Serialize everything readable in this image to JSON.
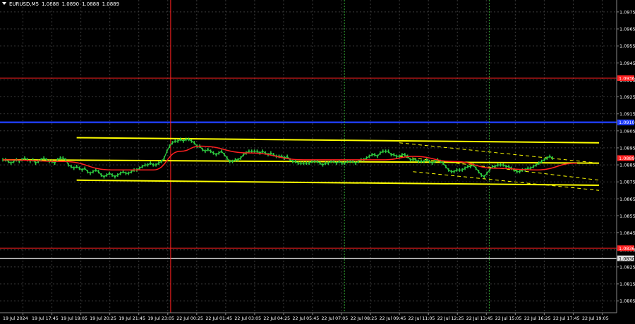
{
  "header": {
    "symbol": "EURUSD,M5",
    "quote": [
      "1.0888",
      "1.0890",
      "1.0888",
      "1.0889"
    ]
  },
  "colors": {
    "background": "#000000",
    "grid": "#3a3a3a",
    "price_line_main": "#2ecc40",
    "channel": "#ffff00",
    "ma": "#ff2020",
    "support_blue": "#1e3cff",
    "red_level": "#ff2020",
    "white_level": "#e0e0e0",
    "vline_red": "#ff2020",
    "vline_green": "#33aa33"
  },
  "price_axis": {
    "ticks": [
      "1.0975",
      "1.0965",
      "1.0955",
      "1.0945",
      "1.0935",
      "1.0925",
      "1.0915",
      "1.0905",
      "1.0895",
      "1.0885",
      "1.0875",
      "1.0865",
      "1.0855",
      "1.0845",
      "1.0835",
      "1.0825",
      "1.0815",
      "1.0805"
    ],
    "level_labels": {
      "red_top": "1.0936",
      "blue": "1.0910",
      "current": "1.0889",
      "red_bottom": "1.0836",
      "white": "1.0830"
    }
  },
  "time_axis": {
    "labels": [
      "19 Jul 2024",
      "19 Jul 17:45",
      "19 Jul 19:05",
      "19 Jul 20:25",
      "19 Jul 21:45",
      "19 Jul 23:05",
      "22 Jul 00:25",
      "22 Jul 01:45",
      "22 Jul 03:05",
      "22 Jul 04:25",
      "22 Jul 05:45",
      "22 Jul 07:05",
      "22 Jul 08:25",
      "22 Jul 09:45",
      "22 Jul 11:05",
      "22 Jul 12:25",
      "22 Jul 13:45",
      "22 Jul 15:05",
      "22 Jul 16:25",
      "22 Jul 17:45",
      "22 Jul 19:05"
    ]
  },
  "chart_data": {
    "type": "line",
    "symbol": "EURUSD,M5",
    "ylim": [
      1.0798,
      1.0982
    ],
    "grid": true,
    "x_index_range": [
      0,
      210
    ],
    "price_series": [
      1.0888,
      1.0888,
      1.0887,
      1.0886,
      1.0887,
      1.0888,
      1.0887,
      1.0888,
      1.0889,
      1.0888,
      1.0887,
      1.0888,
      1.0886,
      1.0887,
      1.0888,
      1.0889,
      1.0888,
      1.0887,
      1.0887,
      1.0886,
      1.0888,
      1.0889,
      1.0889,
      1.0888,
      1.0885,
      1.0884,
      1.0883,
      1.0884,
      1.0883,
      1.0882,
      1.0883,
      1.0881,
      1.088,
      1.0881,
      1.0882,
      1.0881,
      1.0879,
      1.0878,
      1.0879,
      1.088,
      1.0879,
      1.0878,
      1.0879,
      1.088,
      1.0881,
      1.088,
      1.088,
      1.0881,
      1.0882,
      1.0882,
      1.0883,
      1.0884,
      1.0885,
      1.0885,
      1.0886,
      1.0885,
      1.0885,
      1.0886,
      1.0887,
      1.0889,
      1.0893,
      1.0896,
      1.0898,
      1.0899,
      1.0899,
      1.09,
      1.0899,
      1.09,
      1.09,
      1.0899,
      1.0898,
      1.0896,
      1.0896,
      1.0894,
      1.0893,
      1.0894,
      1.0893,
      1.0892,
      1.0891,
      1.0892,
      1.0893,
      1.0891,
      1.0889,
      1.0887,
      1.0887,
      1.0888,
      1.0888,
      1.0889,
      1.0891,
      1.0892,
      1.0893,
      1.0893,
      1.0893,
      1.0893,
      1.0892,
      1.0893,
      1.0892,
      1.0891,
      1.0892,
      1.0891,
      1.089,
      1.089,
      1.089,
      1.0889,
      1.089,
      1.0888,
      1.0887,
      1.0887,
      1.0886,
      1.0886,
      1.0886,
      1.0886,
      1.0886,
      1.0887,
      1.0887,
      1.0887,
      1.0886,
      1.0885,
      1.0886,
      1.0886,
      1.0887,
      1.0887,
      1.0886,
      1.0887,
      1.0886,
      1.0886,
      1.0887,
      1.0887,
      1.0887,
      1.0886,
      1.0887,
      1.0888,
      1.0888,
      1.0889,
      1.089,
      1.0891,
      1.0891,
      1.089,
      1.0892,
      1.0893,
      1.0893,
      1.0893,
      1.0891,
      1.0891,
      1.089,
      1.089,
      1.0891,
      1.0891,
      1.089,
      1.0888,
      1.0888,
      1.0888,
      1.0887,
      1.0887,
      1.0887,
      1.0888,
      1.0887,
      1.0886,
      1.0887,
      1.0888,
      1.0887,
      1.0886,
      1.0884,
      1.0882,
      1.0881,
      1.0881,
      1.0882,
      1.0882,
      1.0882,
      1.0883,
      1.0884,
      1.0884,
      1.0885,
      1.0883,
      1.0881,
      1.0879,
      1.0878,
      1.088,
      1.0882,
      1.0884,
      1.0884,
      1.0885,
      1.0885,
      1.0885,
      1.0884,
      1.0884,
      1.0883,
      1.0882,
      1.0881,
      1.0881,
      1.0882,
      1.0882,
      1.0883,
      1.0883,
      1.0884,
      1.0885,
      1.0886,
      1.0887,
      1.0888,
      1.0889,
      1.089,
      1.0889
    ],
    "moving_average_breakpoints": [
      [
        0,
        1.0888
      ],
      [
        22,
        1.0887
      ],
      [
        40,
        1.0882
      ],
      [
        55,
        1.0882
      ],
      [
        65,
        1.0893
      ],
      [
        72,
        1.0896
      ],
      [
        90,
        1.0892
      ],
      [
        110,
        1.0888
      ],
      [
        140,
        1.0888
      ],
      [
        150,
        1.089
      ],
      [
        165,
        1.0887
      ],
      [
        180,
        1.0883
      ],
      [
        195,
        1.0882
      ],
      [
        210,
        1.0886
      ]
    ],
    "channel_lines": [
      {
        "name": "channel-upper",
        "x": [
          27,
          218
        ],
        "y": [
          1.0901,
          1.0898
        ]
      },
      {
        "name": "channel-middle",
        "x": [
          0,
          218
        ],
        "y": [
          1.0888,
          1.0886
        ]
      },
      {
        "name": "channel-lower",
        "x": [
          27,
          218
        ],
        "y": [
          1.0876,
          1.0873
        ]
      }
    ],
    "dashed_lines": [
      {
        "name": "dashed-trend-upper",
        "x": [
          145,
          218
        ],
        "y": [
          1.0898,
          1.0886
        ]
      },
      {
        "name": "dashed-trend-middle",
        "x": [
          145,
          218
        ],
        "y": [
          1.089,
          1.0876
        ]
      },
      {
        "name": "dashed-trend-lower",
        "x": [
          150,
          218
        ],
        "y": [
          1.0881,
          1.087
        ]
      }
    ],
    "horizontal_levels": [
      {
        "name": "red-level-top",
        "value": 1.0936,
        "color": "red"
      },
      {
        "name": "blue-level",
        "value": 1.091,
        "color": "blue"
      },
      {
        "name": "red-level-bottom",
        "value": 1.0836,
        "color": "red"
      },
      {
        "name": "white-level",
        "value": 1.083,
        "color": "white"
      }
    ],
    "vertical_markers": [
      {
        "name": "session-divider-red",
        "x_label": "19 Jul 23:05",
        "color": "red"
      },
      {
        "name": "session-divider-green-1",
        "x_label": "22 Jul 07:05",
        "color": "green"
      },
      {
        "name": "session-divider-green-2",
        "x_label": "22 Jul 13:45",
        "color": "green"
      }
    ]
  }
}
